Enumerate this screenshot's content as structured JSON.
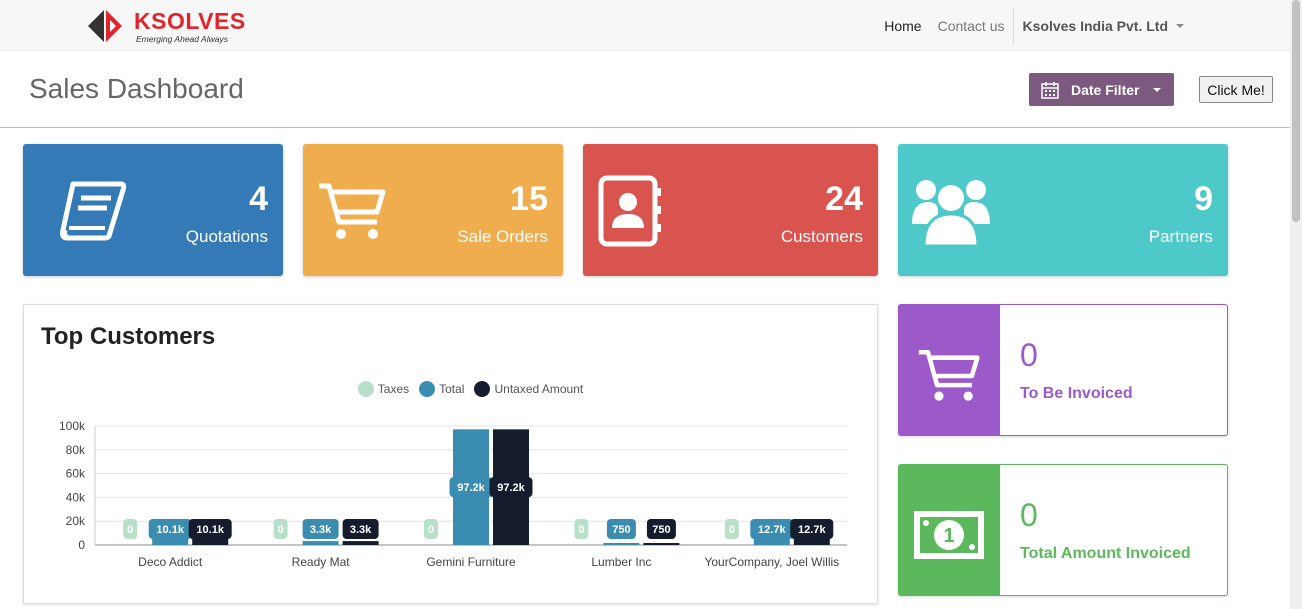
{
  "brand": {
    "name": "KSOLVES",
    "tagline": "Emerging Ahead Always"
  },
  "nav": {
    "home": "Home",
    "contact": "Contact us",
    "company": "Ksolves India Pvt. Ltd"
  },
  "header": {
    "title": "Sales Dashboard",
    "date_filter": "Date Filter",
    "click_me": "Click Me!"
  },
  "tiles": {
    "quotations": {
      "value": "4",
      "label": "Quotations",
      "color": "#337ab7",
      "icon": "book-icon"
    },
    "sale_orders": {
      "value": "15",
      "label": "Sale Orders",
      "color": "#f0ad4e",
      "icon": "cart-icon"
    },
    "customers": {
      "value": "24",
      "label": "Customers",
      "color": "#d9534f",
      "icon": "contact-book-icon"
    },
    "partners": {
      "value": "9",
      "label": "Partners",
      "color": "#4ec9c9",
      "icon": "users-icon"
    }
  },
  "invoices": {
    "to_be_invoiced": {
      "value": "0",
      "label": "To Be Invoiced",
      "color": "#9b59c9"
    },
    "total_invoiced": {
      "value": "0",
      "label": "Total Amount Invoiced",
      "color": "#5cb85c"
    }
  },
  "top_customers": {
    "title": "Top Customers"
  },
  "chart_data": {
    "type": "bar",
    "categories": [
      "Deco Addict",
      "Ready Mat",
      "Gemini Furniture",
      "Lumber Inc",
      "YourCompany, Joel Willis"
    ],
    "series": [
      {
        "name": "Taxes",
        "color": "#b8dfc8",
        "values": [
          0,
          0,
          0,
          0,
          0
        ],
        "labels": [
          "0",
          "0",
          "0",
          "0",
          "0"
        ]
      },
      {
        "name": "Total",
        "color": "#3a8db0",
        "values": [
          10100,
          3300,
          97200,
          750,
          12700
        ],
        "labels": [
          "10.1k",
          "3.3k",
          "97.2k",
          "750",
          "12.7k"
        ]
      },
      {
        "name": "Untaxed Amount",
        "color": "#141c2e",
        "values": [
          10100,
          3300,
          97200,
          750,
          12700
        ],
        "labels": [
          "10.1k",
          "3.3k",
          "97.2k",
          "750",
          "12.7k"
        ]
      }
    ],
    "yticks": [
      "0",
      "20k",
      "40k",
      "60k",
      "80k",
      "100k"
    ],
    "ylim": [
      0,
      100000
    ],
    "grid": true,
    "legend": "top-center"
  }
}
